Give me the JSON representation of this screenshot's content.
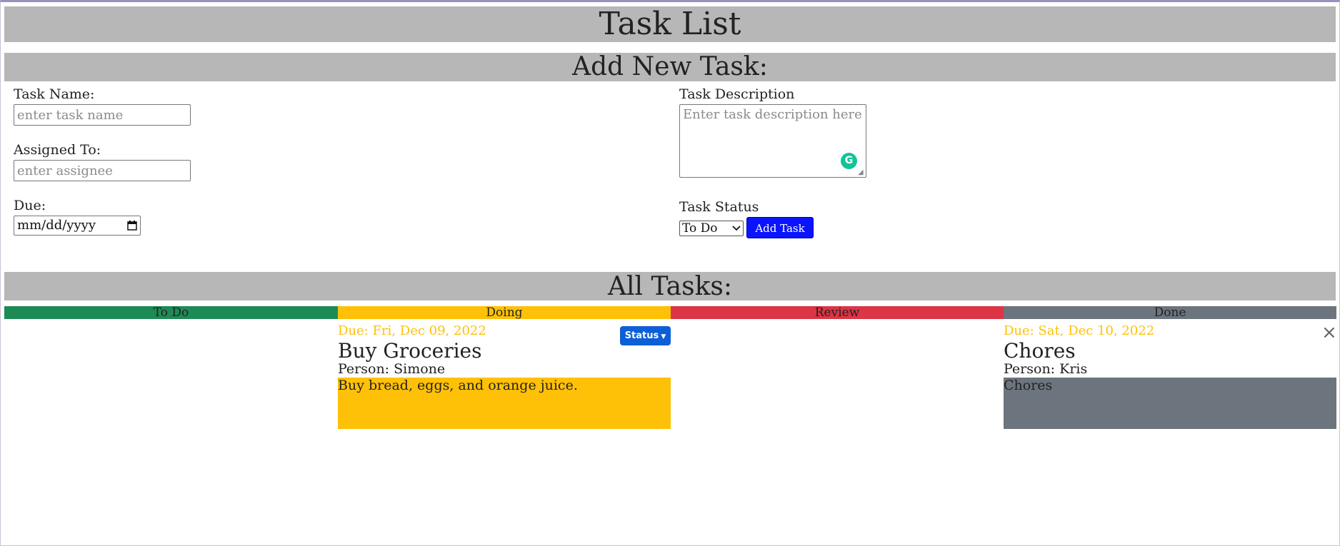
{
  "header": {
    "title": "Task List"
  },
  "form": {
    "heading": "Add New Task:",
    "task_name_label": "Task Name:",
    "task_name_placeholder": "enter task name",
    "assigned_label": "Assigned To:",
    "assigned_placeholder": "enter assignee",
    "due_label": "Due:",
    "due_value": "mm/dd/yyyy",
    "description_label": "Task Description",
    "description_placeholder": "Enter task description here",
    "status_label": "Task Status",
    "status_selected": "To Do",
    "add_button_label": "Add Task"
  },
  "board": {
    "heading": "All Tasks:",
    "columns": [
      {
        "label": "To Do",
        "color": "#1e8a55"
      },
      {
        "label": "Doing",
        "color": "#ffc107"
      },
      {
        "label": "Review",
        "color": "#dc3545"
      },
      {
        "label": "Done",
        "color": "#6c757d"
      }
    ],
    "cards": [
      {
        "column": "Doing",
        "due": "Due: Fri, Dec 09, 2022",
        "title": "Buy Groceries",
        "person": "Person: Simone",
        "description": "Buy bread, eggs, and orange juice.",
        "status_button": "Status"
      },
      {
        "column": "Done",
        "due": "Due: Sat, Dec 10, 2022",
        "title": "Chores",
        "person": "Person: Kris",
        "description": "Chores",
        "close_glyph": "×"
      }
    ]
  },
  "icons": {
    "grammarly": "grammarly-icon",
    "calendar": "calendar-icon",
    "select_arrow": "chevron-down-icon"
  },
  "colors": {
    "due_text": "#ffc107",
    "add_button": "#0a14ff",
    "status_button": "#0d5fd8",
    "band": "#b7b7b7"
  }
}
